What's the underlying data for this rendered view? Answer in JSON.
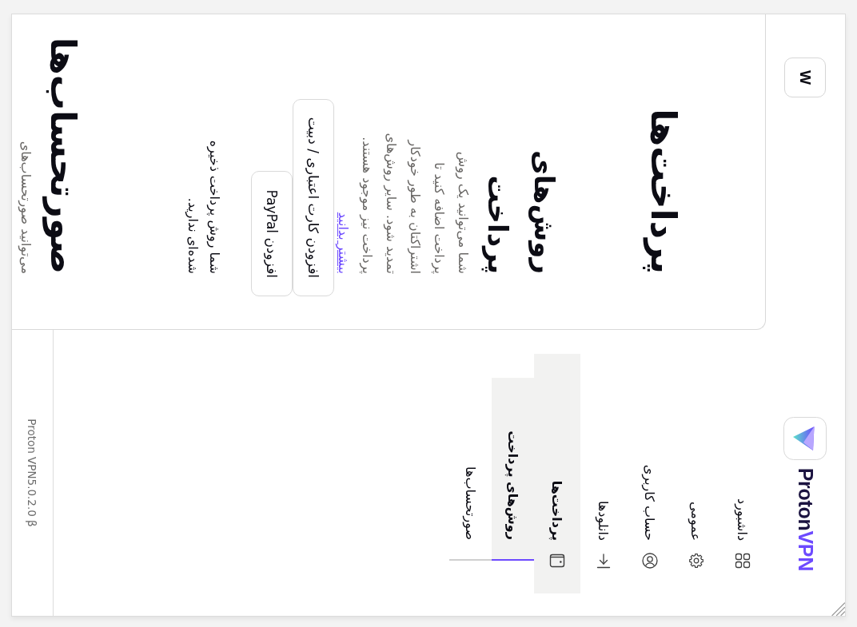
{
  "sidebar": {
    "logo": {
      "brand": "Proton",
      "product": "VPN"
    },
    "items": [
      {
        "label": "داشبورد",
        "selected": false
      },
      {
        "label": "عمومی",
        "selected": false
      },
      {
        "label": "حساب کاربری",
        "selected": false
      },
      {
        "label": "دانلودها",
        "selected": false
      },
      {
        "label": "پرداخت‌ها",
        "selected": true,
        "children": [
          {
            "label": "روش‌های پرداخت",
            "selected": true
          },
          {
            "label": "صورتحساب‌ها",
            "selected": false
          }
        ]
      }
    ],
    "version": "Proton VPN5.0.2.0 β"
  },
  "header": {
    "avatar": "W"
  },
  "content": {
    "title": "پرداخت‌ها",
    "payment_methods": {
      "heading": "روش‌های پرداخت",
      "description_lines": [
        "شما می‌توانید یک روش",
        "پرداخت اضافه کنید تا",
        "اشتراکتان به طور خودکار",
        "تمدید شود. سایر روش‌های",
        "پرداخت نیز موجود هستند."
      ],
      "link": "بیشتر بدانید",
      "buttons": [
        "افزودن کارت اعتباری / دبیت",
        "افزودن PayPal"
      ],
      "empty_lines": [
        "شما روش پرداخت ذخیره",
        "شده‌ای ندارید."
      ]
    },
    "invoices": {
      "heading": "صورتحساب‌ها",
      "description": "می‌توانید صورتحساب‌های"
    }
  }
}
